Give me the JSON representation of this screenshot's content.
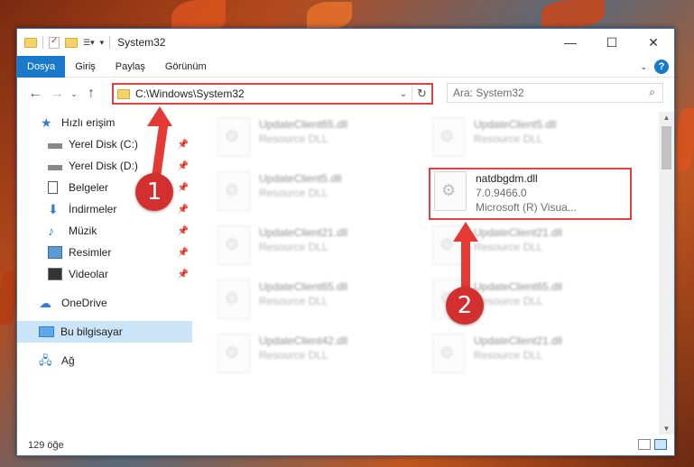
{
  "window": {
    "title": "System32"
  },
  "ribbon": {
    "tabs": [
      "Dosya",
      "Giriş",
      "Paylaş",
      "Görünüm"
    ],
    "active_tab": "Dosya"
  },
  "address": {
    "path": "C:\\Windows\\System32"
  },
  "search": {
    "placeholder": "Ara: System32"
  },
  "sidebar": {
    "items": [
      {
        "label": "Hızlı erişim",
        "icon": "star-icon"
      },
      {
        "label": "Yerel Disk (C:)",
        "icon": "drive-icon",
        "pinned": true
      },
      {
        "label": "Yerel Disk (D:)",
        "icon": "drive-icon",
        "pinned": true
      },
      {
        "label": "Belgeler",
        "icon": "documents-icon",
        "pinned": true
      },
      {
        "label": "İndirmeler",
        "icon": "download-icon",
        "pinned": true
      },
      {
        "label": "Müzik",
        "icon": "music-icon",
        "pinned": true
      },
      {
        "label": "Resimler",
        "icon": "pictures-icon",
        "pinned": true
      },
      {
        "label": "Videolar",
        "icon": "video-icon",
        "pinned": true
      },
      {
        "label": "OneDrive",
        "icon": "cloud-icon"
      },
      {
        "label": "Bu bilgisayar",
        "icon": "computer-icon",
        "selected": true
      },
      {
        "label": "Ağ",
        "icon": "network-icon"
      }
    ]
  },
  "files": [
    {
      "name": "UpdateClient65.dll",
      "desc": "Resource DLL"
    },
    {
      "name": "UpdateClient5.dll",
      "desc": "Resource DLL"
    },
    {
      "name": "UpdateClient5.dll",
      "desc": "Resource DLL"
    },
    {
      "name": "natdbgdm.dll",
      "version": "7.0.9466.0",
      "desc": "Microsoft (R) Visua...",
      "highlighted": true
    },
    {
      "name": "UpdateClient21.dll",
      "desc": "Resource DLL"
    },
    {
      "name": "UpdateClient21.dll",
      "desc": "Resource DLL"
    },
    {
      "name": "UpdateClient65.dll",
      "desc": "Resource DLL"
    },
    {
      "name": "UpdateClient65.dll",
      "desc": "Resource DLL"
    },
    {
      "name": "UpdateClient42.dll",
      "desc": "Resource DLL"
    },
    {
      "name": "UpdateClient21.dll",
      "desc": "Resource DLL"
    }
  ],
  "status": {
    "count": "129 öğe"
  },
  "annotations": {
    "badge1": "1",
    "badge2": "2"
  },
  "colors": {
    "accent": "#1979ca",
    "highlight": "#e04040",
    "arrow": "#e53935"
  }
}
